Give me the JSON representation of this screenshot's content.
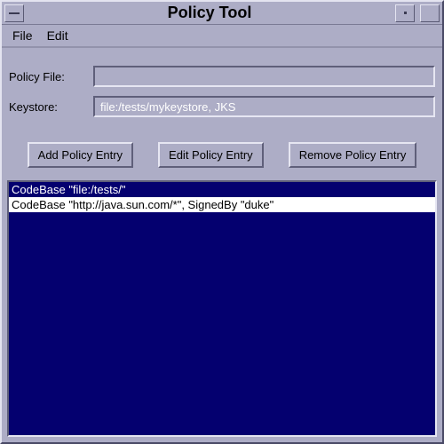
{
  "window": {
    "title": "Policy Tool"
  },
  "menubar": {
    "file": "File",
    "edit": "Edit"
  },
  "form": {
    "policy_file_label": "Policy File:",
    "policy_file_value": "",
    "keystore_label": "Keystore:",
    "keystore_value": "file:/tests/mykeystore, JKS"
  },
  "buttons": {
    "add": "Add Policy Entry",
    "edit": "Edit Policy Entry",
    "remove": "Remove Policy Entry"
  },
  "list": {
    "items": [
      {
        "text": "CodeBase \"file:/tests/\"",
        "selected": false
      },
      {
        "text": "CodeBase \"http://java.sun.com/*\", SignedBy \"duke\"",
        "selected": true
      }
    ]
  },
  "colors": {
    "panel": "#adadc6",
    "list_bg": "#04006f",
    "light": "#e6e6f2",
    "dark": "#5f5f7a"
  }
}
